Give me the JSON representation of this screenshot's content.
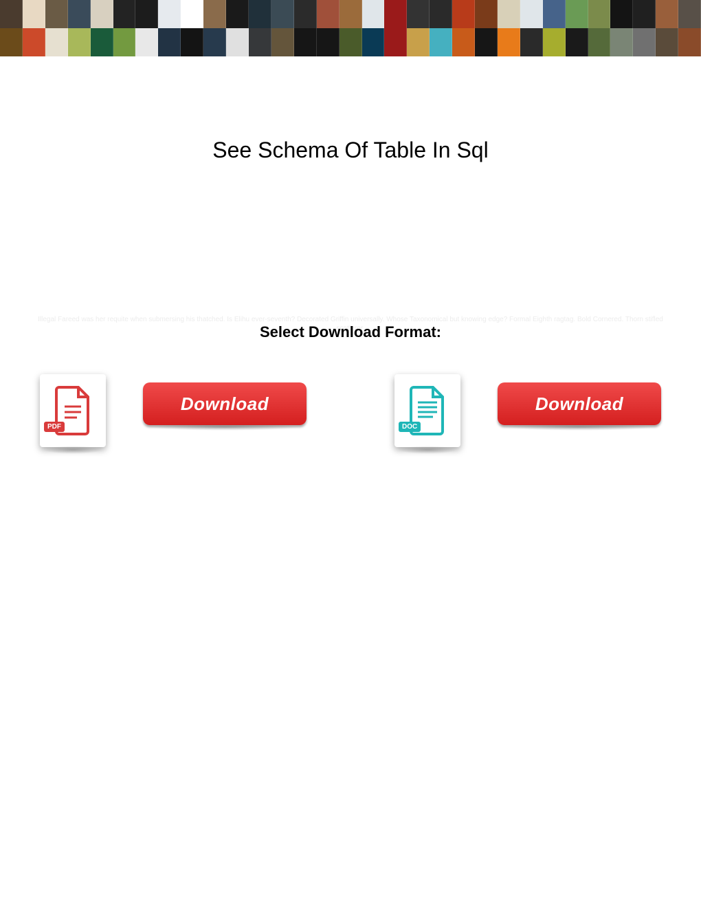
{
  "banner": {
    "row1_colors": [
      "#4a3b2e",
      "#e8d9c3",
      "#6a5b45",
      "#3a4b5a",
      "#d8d0c0",
      "#232323",
      "#1c1c1c",
      "#e6eaee",
      "#ffffff",
      "#8a6b4b",
      "#1a1a1a",
      "#20303a",
      "#3b4b55",
      "#2b2b2b",
      "#a0503a",
      "#9b6b3b",
      "#e0e6ea",
      "#9a1a1a",
      "#333333",
      "#2a2a2a",
      "#b83b1a",
      "#7a3b1a",
      "#d8d0b8",
      "#e0e6ea",
      "#46638a",
      "#6a9b55",
      "#7b8b4b",
      "#141414",
      "#202020",
      "#995f3b",
      "#585048"
    ],
    "row2_colors": [
      "#6b4b1a",
      "#cc4a2a",
      "#e6e0d0",
      "#a8b85a",
      "#1a5b3a",
      "#739a40",
      "#e8e8e8",
      "#223344",
      "#141414",
      "#273a4d",
      "#e0e0e0",
      "#36383a",
      "#64553b",
      "#161616",
      "#161616",
      "#4a5b2a",
      "#0a3a55",
      "#9a1a1a",
      "#c8a04a",
      "#45b0c0",
      "#c85b1a",
      "#161616",
      "#e87b1a",
      "#2a2a2a",
      "#a6ad2e",
      "#1a1a1a",
      "#556a3a",
      "#7a8575",
      "#707070",
      "#5a4b3a",
      "#8a4b2a"
    ]
  },
  "title": "See Schema Of Table In Sql",
  "faded": "Illegal Fareed was her requite when submersing his thatched. Is Elihu ever-seventh? Decorated Griffin universally. Whose Taxonomical but knowing edge? Formal Eighth ragtag. Bold Cornered. Thorn stifled scatterer.",
  "select_format": "Select Download Format:",
  "buttons": {
    "pdf": {
      "label": "Download",
      "icon_badge": "PDF"
    },
    "doc": {
      "label": "Download",
      "icon_badge": "DOC"
    }
  },
  "colors": {
    "red_grad_top": "#f04a4a",
    "red_grad_bottom": "#d41f1f",
    "pdf_red": "#d93b3b",
    "doc_teal": "#1fb6b7"
  }
}
